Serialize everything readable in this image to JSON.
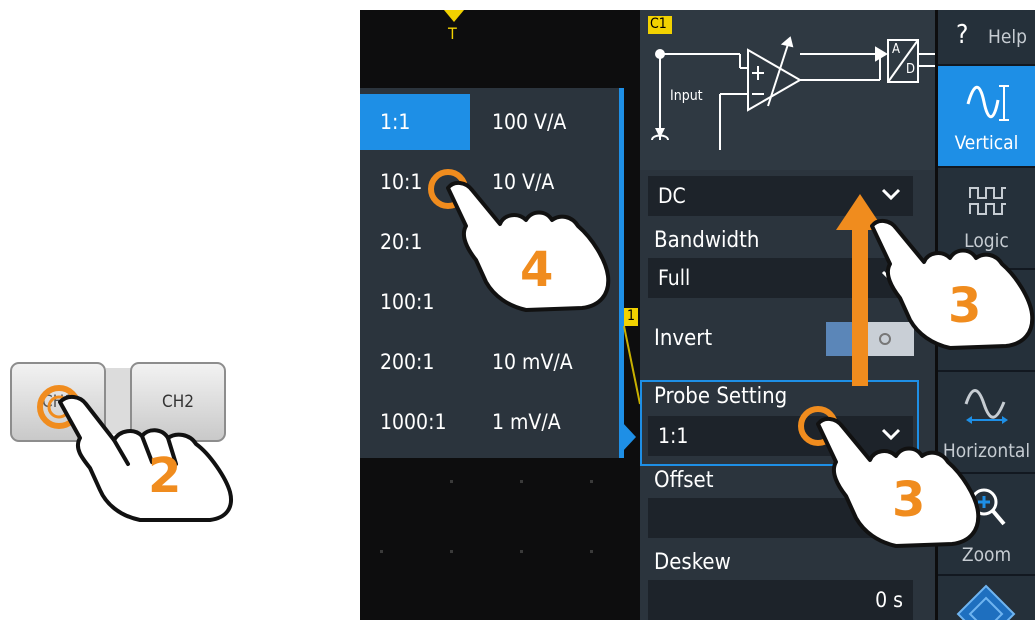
{
  "hardware": {
    "ch1_label": "CH1",
    "ch2_label": "CH2"
  },
  "trigger_marker": "T",
  "probe_list": [
    {
      "ratio": "1:1",
      "value": "100 V/A",
      "selected": true
    },
    {
      "ratio": "10:1",
      "value": "10 V/A",
      "selected": false
    },
    {
      "ratio": "20:1",
      "value": "",
      "selected": false
    },
    {
      "ratio": "100:1",
      "value": "",
      "selected": false
    },
    {
      "ratio": "200:1",
      "value": "10 mV/A",
      "selected": false
    },
    {
      "ratio": "1000:1",
      "value": "1 mV/A",
      "selected": false
    }
  ],
  "diagram": {
    "channel_badge": "C1",
    "input_label": "Input",
    "adc_top": "A",
    "adc_bottom": "D"
  },
  "settings": {
    "coupling_value": "DC",
    "bandwidth_label": "Bandwidth",
    "bandwidth_value": "Full",
    "invert_label": "Invert",
    "probe_setting_label": "Probe Setting",
    "probe_setting_value": "1:1",
    "offset_label": "Offset",
    "offset_value": "",
    "deskew_label": "Deskew",
    "deskew_value": "0 s"
  },
  "channel_marker": "1",
  "sidebar": {
    "help": "Help",
    "help_glyph": "?",
    "vertical": "Vertical",
    "logic": "Logic",
    "horizontal": "Horizontal",
    "zoom": "Zoom"
  },
  "steps": {
    "step2": "2",
    "step3a": "3",
    "step3b": "3",
    "step4": "4"
  },
  "colors": {
    "accent_blue": "#1e8fe6",
    "step_orange": "#f08c1e",
    "badge_yellow": "#f2d200"
  }
}
